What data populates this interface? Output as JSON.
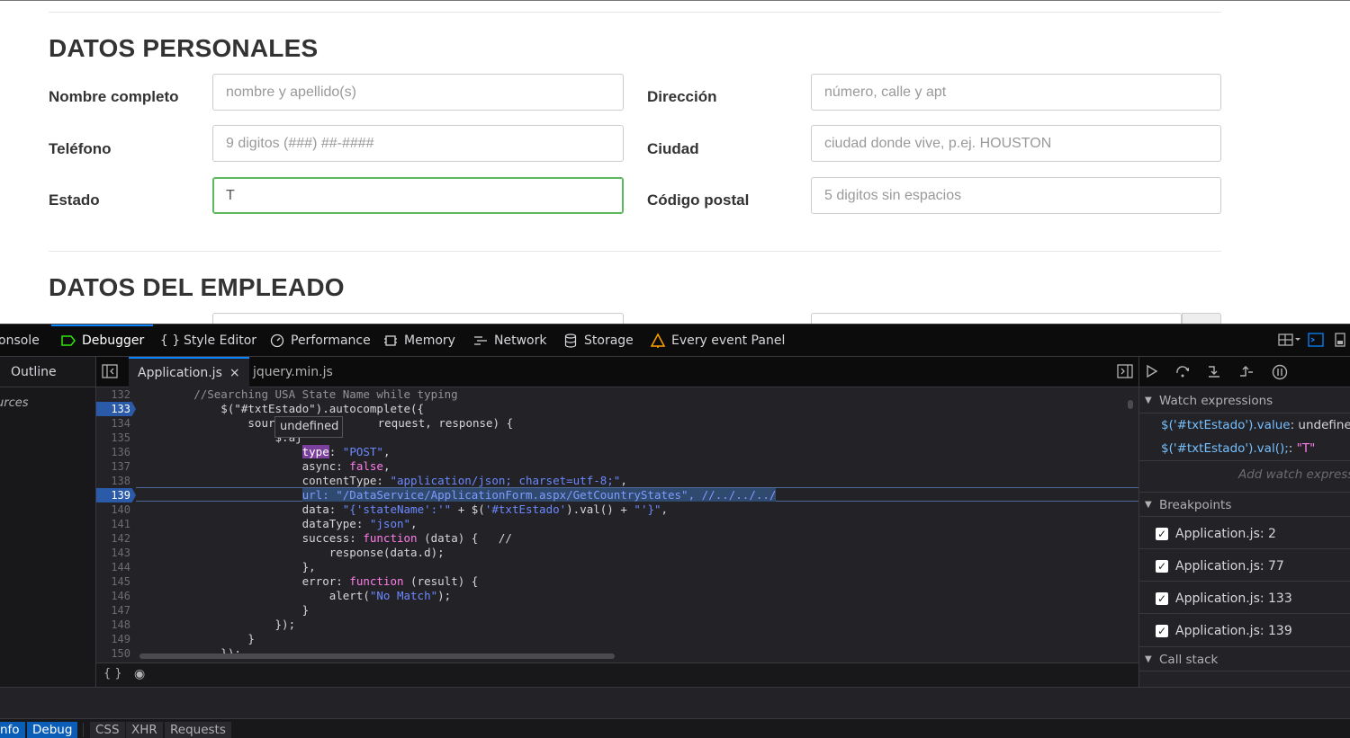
{
  "form": {
    "section1_title": "DATOS PERSONALES",
    "section2_title": "DATOS DEL EMPLEADO",
    "fields": {
      "nombre": {
        "label": "Nombre completo",
        "placeholder": "nombre y apellido(s)",
        "value": ""
      },
      "telefono": {
        "label": "Teléfono",
        "placeholder": "9 digitos (###) ##-####",
        "value": ""
      },
      "estado": {
        "label": "Estado",
        "placeholder": "",
        "value": "T"
      },
      "direccion": {
        "label": "Dirección",
        "placeholder": "número, calle y apt",
        "value": ""
      },
      "ciudad": {
        "label": "Ciudad",
        "placeholder": "ciudad donde vive, p.ej. HOUSTON",
        "value": ""
      },
      "codigo": {
        "label": "Código postal",
        "placeholder": "5 digitos sin espacios",
        "value": ""
      }
    }
  },
  "devtools": {
    "tabs": {
      "console": "onsole",
      "debugger": "Debugger",
      "style_editor": "Style Editor",
      "performance": "Performance",
      "memory": "Memory",
      "network": "Network",
      "storage": "Storage",
      "every_event": "Every event Panel"
    },
    "outline": {
      "label": "Outline",
      "sources_label": "urces"
    },
    "editor_tabs": {
      "file1": "Application.js",
      "file1_close": "×",
      "file2": "jquery.min.js"
    },
    "tooltip": "undefined",
    "code": {
      "lines": [
        {
          "n": "132",
          "bp": false
        },
        {
          "n": "133",
          "bp": true
        },
        {
          "n": "134",
          "bp": false
        },
        {
          "n": "135",
          "bp": false
        },
        {
          "n": "136",
          "bp": false
        },
        {
          "n": "137",
          "bp": false
        },
        {
          "n": "138",
          "bp": false
        },
        {
          "n": "139",
          "bp": true
        },
        {
          "n": "140",
          "bp": false
        },
        {
          "n": "141",
          "bp": false
        },
        {
          "n": "142",
          "bp": false
        },
        {
          "n": "143",
          "bp": false
        },
        {
          "n": "144",
          "bp": false
        },
        {
          "n": "145",
          "bp": false
        },
        {
          "n": "146",
          "bp": false
        },
        {
          "n": "147",
          "bp": false
        },
        {
          "n": "148",
          "bp": false
        },
        {
          "n": "149",
          "bp": false
        },
        {
          "n": "150",
          "bp": false
        }
      ],
      "t132": "        //Searching USA State Name while typing",
      "t133a": "            $(\"#txtEstado\")",
      "t133b": ".autocomplete({",
      "t134a": "                source: ",
      "t134b": "request, response) {",
      "t135": "                    $.aj",
      "t136a": "                        ",
      "t136b": "type",
      "t136c": ": ",
      "t136d": "\"POST\"",
      "t136e": ",",
      "t137a": "                        async: ",
      "t137b": "false",
      "t137c": ",",
      "t138a": "                        contentType: ",
      "t138b": "\"application/json; charset=utf-8;\"",
      "t138c": ",",
      "t139a": "                        ",
      "t139b": "url: \"/DataService/ApplicationForm.aspx/GetCountryStates\", //../../../",
      "t140a": "                        data: ",
      "t140b": "\"{'stateName':'\"",
      "t140c": " + $(",
      "t140d": "'#txtEstado'",
      "t140e": ").val() + ",
      "t140f": "\"'}\"",
      "t140g": ",",
      "t141a": "                        dataType: ",
      "t141b": "\"json\"",
      "t141c": ",",
      "t142a": "                        success: ",
      "t142b": "function",
      "t142c": " (data) {   //",
      "t143": "                            response(data.d);",
      "t144": "                        },",
      "t145a": "                        error: ",
      "t145b": "function",
      "t145c": " (result) {",
      "t146a": "                            alert(",
      "t146b": "\"No Match\"",
      "t146c": ");",
      "t147": "                        }",
      "t148": "                    });",
      "t149": "                }",
      "t150": "            });"
    },
    "footer": {
      "braces": "{ }",
      "eye": "◉"
    },
    "sidebar": {
      "watch_title": "Watch expressions",
      "watch1_expr": "$('#txtEstado').value",
      "watch1_sep": ": ",
      "watch1_val": "undefined",
      "watch2_expr": "$('#txtEstado').val();",
      "watch2_sep": ": ",
      "watch2_val": "\"T\"",
      "add_watch": "Add watch expressio",
      "breakpoints_title": "Breakpoints",
      "breakpoints": [
        "Application.js: 2",
        "Application.js: 77",
        "Application.js: 133",
        "Application.js: 139"
      ],
      "callstack_title": "Call stack"
    },
    "console_filters": {
      "info": "nfo",
      "debug": "Debug",
      "css": "CSS",
      "xhr": "XHR",
      "requests": "Requests"
    }
  },
  "colors": {
    "accent": "#0a84ff",
    "breakpoint": "#2a5aa8",
    "active_border": "#5cb85c"
  }
}
